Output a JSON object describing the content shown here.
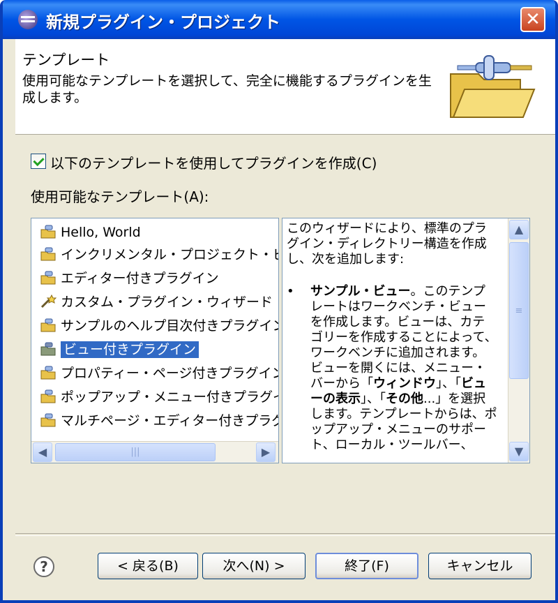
{
  "window": {
    "title": "新規プラグイン・プロジェクト",
    "close_label": "✕"
  },
  "header": {
    "title": "テンプレート",
    "description": "使用可能なテンプレートを選択して、完全に機能するプラグインを生成します。"
  },
  "options": {
    "use_template_checked": true,
    "use_template_label": "以下のテンプレートを使用してプラグインを作成(C)",
    "templates_label": "使用可能なテンプレート(A):"
  },
  "templates": [
    {
      "label": "Hello, World",
      "icon": "plugin-icon"
    },
    {
      "label": "インクリメンタル・プロジェクト・ビルダー",
      "icon": "plugin-icon"
    },
    {
      "label": "エディター付きプラグイン",
      "icon": "plugin-icon"
    },
    {
      "label": "カスタム・プラグイン・ウィザード",
      "icon": "wizard-icon"
    },
    {
      "label": "サンプルのヘルプ目次付きプラグイン",
      "icon": "plugin-icon"
    },
    {
      "label": "ビュー付きプラグイン",
      "icon": "plugin-icon",
      "selected": true
    },
    {
      "label": "プロパティー・ページ付きプラグイン",
      "icon": "plugin-icon"
    },
    {
      "label": "ポップアップ・メニュー付きプラグイン",
      "icon": "plugin-icon"
    },
    {
      "label": "マルチページ・エディター付きプラグイン",
      "icon": "plugin-icon"
    }
  ],
  "description": {
    "intro": "このウィザードにより、標準のプラグイン・ディレクトリー構造を作成し、次を追加します:",
    "bullet": "•",
    "item_title": "サンプル・ビュー",
    "item_text_1": "。このテンプレートはワークベンチ・ビューを作成します。ビューは、カテゴリーを作成することによって、ワークベンチに追加されます。ビューを開くには、メニュー・バーから「",
    "item_bold_1": "ウィンドウ",
    "item_text_2": "」、「",
    "item_bold_2": "ビューの表示",
    "item_text_3": "」、「",
    "item_bold_3": "その他",
    "item_text_4": "...」を選択します。テンプレートからは、ポップアップ・メニューのサポート、ローカル・ツールバー、"
  },
  "scrollbars": {
    "left_arrow": "◀",
    "right_arrow": "▶",
    "up_arrow": "▲",
    "down_arrow": "▼",
    "grip": "|||",
    "vgrip": "≡"
  },
  "buttons": {
    "help": "?",
    "back": "< 戻る(B)",
    "next": "次へ(N) >",
    "finish": "終了(F)",
    "cancel": "キャンセル"
  }
}
